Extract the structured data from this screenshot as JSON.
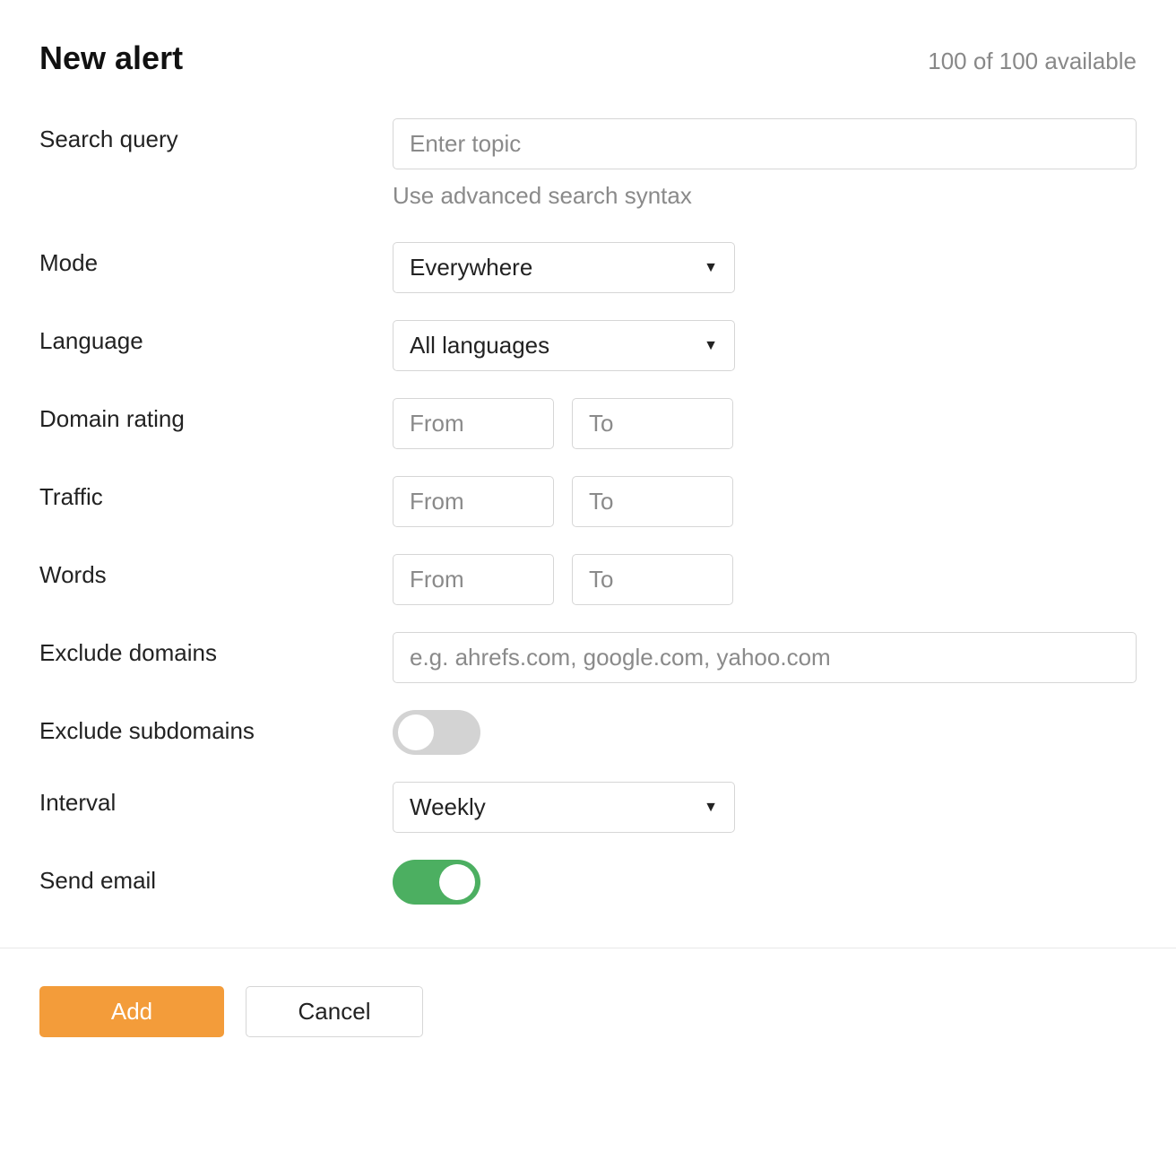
{
  "header": {
    "title": "New alert",
    "availability": "100 of 100 available"
  },
  "fields": {
    "search_query": {
      "label": "Search query",
      "placeholder": "Enter topic",
      "hint": "Use advanced search syntax",
      "value": ""
    },
    "mode": {
      "label": "Mode",
      "selected": "Everywhere"
    },
    "language": {
      "label": "Language",
      "selected": "All languages"
    },
    "domain_rating": {
      "label": "Domain rating",
      "from_placeholder": "From",
      "to_placeholder": "To",
      "from_value": "",
      "to_value": ""
    },
    "traffic": {
      "label": "Traffic",
      "from_placeholder": "From",
      "to_placeholder": "To",
      "from_value": "",
      "to_value": ""
    },
    "words": {
      "label": "Words",
      "from_placeholder": "From",
      "to_placeholder": "To",
      "from_value": "",
      "to_value": ""
    },
    "exclude_domains": {
      "label": "Exclude domains",
      "placeholder": "e.g. ahrefs.com, google.com, yahoo.com",
      "value": ""
    },
    "exclude_subdomains": {
      "label": "Exclude subdomains",
      "on": false
    },
    "interval": {
      "label": "Interval",
      "selected": "Weekly"
    },
    "send_email": {
      "label": "Send email",
      "on": true
    }
  },
  "footer": {
    "add_label": "Add",
    "cancel_label": "Cancel"
  }
}
